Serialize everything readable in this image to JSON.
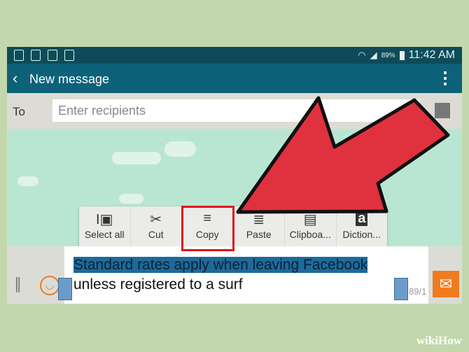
{
  "status_bar": {
    "battery": "89%",
    "time": "11:42 AM",
    "icons": [
      "sync-icon",
      "clean-icon",
      "phone-icon",
      "battery-saver-icon",
      "wifi-icon",
      "signal-icon",
      "battery-icon"
    ]
  },
  "app_bar": {
    "title": "New message",
    "back_icon": "chevron-left-icon",
    "menu_icon": "overflow-menu-icon"
  },
  "recipients": {
    "label": "To",
    "placeholder": "Enter recipients"
  },
  "context_menu": {
    "items": [
      {
        "label": "Select all",
        "icon": "select-all-icon"
      },
      {
        "label": "Cut",
        "icon": "scissors-icon"
      },
      {
        "label": "Copy",
        "icon": "copy-icon",
        "highlighted": true
      },
      {
        "label": "Paste",
        "icon": "paste-icon"
      },
      {
        "label": "Clipboa...",
        "icon": "clipboard-icon"
      },
      {
        "label": "Diction...",
        "icon": "dictionary-icon"
      }
    ]
  },
  "message": {
    "selected_text": "Standard rates apply when leaving Facebook",
    "rest_text": "unless registered to a surf",
    "counter": "89/1"
  },
  "colors": {
    "status_bar": "#0e4b59",
    "app_bar": "#0d6179",
    "selection": "#1d6a9b",
    "highlight_box": "#e0141c",
    "arrow": "#e0323e",
    "send": "#f07b1f"
  },
  "watermark": "wikiHow"
}
